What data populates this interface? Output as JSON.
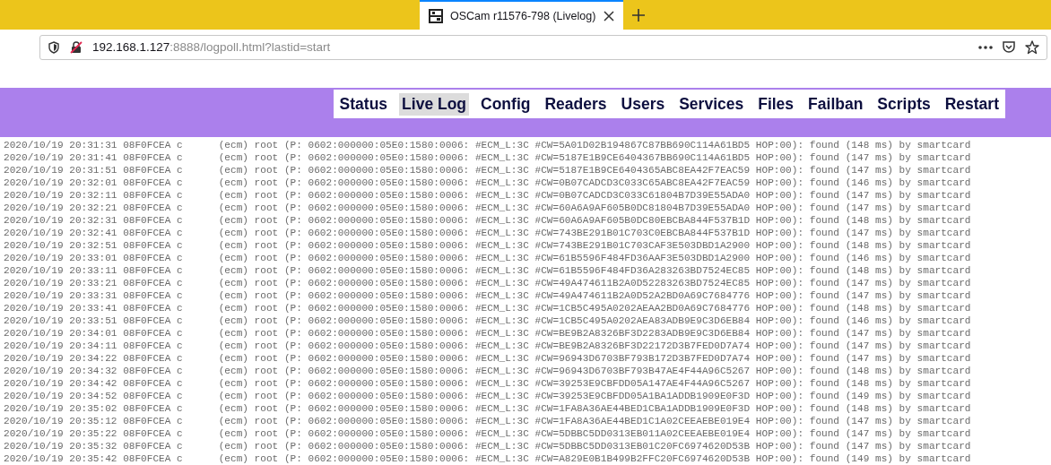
{
  "browser": {
    "tab": {
      "title": "OSCam r11576-798 (Livelog)",
      "selected": true
    },
    "address": {
      "host": "192.168.1.127",
      "rest": ":8888/logpoll.html?lastid=start"
    }
  },
  "menu": [
    {
      "label": "Status",
      "selected": false
    },
    {
      "label": "Live Log",
      "selected": true
    },
    {
      "label": "Config",
      "selected": false
    },
    {
      "label": "Readers",
      "selected": false
    },
    {
      "label": "Users",
      "selected": false
    },
    {
      "label": "Services",
      "selected": false
    },
    {
      "label": "Files",
      "selected": false
    },
    {
      "label": "Failban",
      "selected": false
    },
    {
      "label": "Scripts",
      "selected": false
    },
    {
      "label": "Restart",
      "selected": false
    }
  ],
  "log_lines": [
    "2020/10/19 20:31:31 08F0FCEA c      (ecm) root (P: 0602:000000:05E0:1580:0006: #ECM_L:3C #CW=5A01D02B194867C87BB690C114A61BD5 HOP:00): found (148 ms) by smartcard",
    "2020/10/19 20:31:41 08F0FCEA c      (ecm) root (P: 0602:000000:05E0:1580:0006: #ECM_L:3C #CW=5187E1B9CE6404367BB690C114A61BD5 HOP:00): found (147 ms) by smartcard",
    "2020/10/19 20:31:51 08F0FCEA c      (ecm) root (P: 0602:000000:05E0:1580:0006: #ECM_L:3C #CW=5187E1B9CE6404365ABC8EA42F7EAC59 HOP:00): found (147 ms) by smartcard",
    "2020/10/19 20:32:01 08F0FCEA c      (ecm) root (P: 0602:000000:05E0:1580:0006: #ECM_L:3C #CW=0B07CADCD3C033C65ABC8EA42F7EAC59 HOP:00): found (146 ms) by smartcard",
    "2020/10/19 20:32:11 08F0FCEA c      (ecm) root (P: 0602:000000:05E0:1580:0006: #ECM_L:3C #CW=0B07CADCD3C033C61804B7D39E55ADA0 HOP:00): found (147 ms) by smartcard",
    "2020/10/19 20:32:21 08F0FCEA c      (ecm) root (P: 0602:000000:05E0:1580:0006: #ECM_L:3C #CW=60A6A9AF605B0DC81804B7D39E55ADA0 HOP:00): found (147 ms) by smartcard",
    "2020/10/19 20:32:31 08F0FCEA c      (ecm) root (P: 0602:000000:05E0:1580:0006: #ECM_L:3C #CW=60A6A9AF605B0DC80EBCBA844F537B1D HOP:00): found (148 ms) by smartcard",
    "2020/10/19 20:32:41 08F0FCEA c      (ecm) root (P: 0602:000000:05E0:1580:0006: #ECM_L:3C #CW=743BE291B01C703C0EBCBA844F537B1D HOP:00): found (147 ms) by smartcard",
    "2020/10/19 20:32:51 08F0FCEA c      (ecm) root (P: 0602:000000:05E0:1580:0006: #ECM_L:3C #CW=743BE291B01C703CAF3E503DBD1A2900 HOP:00): found (148 ms) by smartcard",
    "2020/10/19 20:33:01 08F0FCEA c      (ecm) root (P: 0602:000000:05E0:1580:0006: #ECM_L:3C #CW=61B5596F484FD36AAF3E503DBD1A2900 HOP:00): found (146 ms) by smartcard",
    "2020/10/19 20:33:11 08F0FCEA c      (ecm) root (P: 0602:000000:05E0:1580:0006: #ECM_L:3C #CW=61B5596F484FD36A283263BD7524EC85 HOP:00): found (148 ms) by smartcard",
    "2020/10/19 20:33:21 08F0FCEA c      (ecm) root (P: 0602:000000:05E0:1580:0006: #ECM_L:3C #CW=49A474611B2A0D52283263BD7524EC85 HOP:00): found (147 ms) by smartcard",
    "2020/10/19 20:33:31 08F0FCEA c      (ecm) root (P: 0602:000000:05E0:1580:0006: #ECM_L:3C #CW=49A474611B2A0D52A2BD0A69C7684776 HOP:00): found (147 ms) by smartcard",
    "2020/10/19 20:33:41 08F0FCEA c      (ecm) root (P: 0602:000000:05E0:1580:0006: #ECM_L:3C #CW=1CB5C495A0202AEAA2BD0A69C7684776 HOP:00): found (148 ms) by smartcard",
    "2020/10/19 20:33:51 08F0FCEA c      (ecm) root (P: 0602:000000:05E0:1580:0006: #ECM_L:3C #CW=1CB5C495A0202AEA83ADB9E9C3D6EB84 HOP:00): found (146 ms) by smartcard",
    "2020/10/19 20:34:01 08F0FCEA c      (ecm) root (P: 0602:000000:05E0:1580:0006: #ECM_L:3C #CW=BE9B2A8326BF3D2283ADB9E9C3D6EB84 HOP:00): found (147 ms) by smartcard",
    "2020/10/19 20:34:11 08F0FCEA c      (ecm) root (P: 0602:000000:05E0:1580:0006: #ECM_L:3C #CW=BE9B2A8326BF3D22172D3B7FED0D7A74 HOP:00): found (147 ms) by smartcard",
    "2020/10/19 20:34:22 08F0FCEA c      (ecm) root (P: 0602:000000:05E0:1580:0006: #ECM_L:3C #CW=96943D6703BF793B172D3B7FED0D7A74 HOP:00): found (147 ms) by smartcard",
    "2020/10/19 20:34:32 08F0FCEA c      (ecm) root (P: 0602:000000:05E0:1580:0006: #ECM_L:3C #CW=96943D6703BF793B47AE4F44A96C5267 HOP:00): found (148 ms) by smartcard",
    "2020/10/19 20:34:42 08F0FCEA c      (ecm) root (P: 0602:000000:05E0:1580:0006: #ECM_L:3C #CW=39253E9CBFDD05A147AE4F44A96C5267 HOP:00): found (148 ms) by smartcard",
    "2020/10/19 20:34:52 08F0FCEA c      (ecm) root (P: 0602:000000:05E0:1580:0006: #ECM_L:3C #CW=39253E9CBFDD05A1BA1ADDB1909E0F3D HOP:00): found (149 ms) by smartcard",
    "2020/10/19 20:35:02 08F0FCEA c      (ecm) root (P: 0602:000000:05E0:1580:0006: #ECM_L:3C #CW=1FA8A36AE44BED1CBA1ADDB1909E0F3D HOP:00): found (148 ms) by smartcard",
    "2020/10/19 20:35:12 08F0FCEA c      (ecm) root (P: 0602:000000:05E0:1580:0006: #ECM_L:3C #CW=1FA8A36AE44BED1C1A02CEEAEBE019E4 HOP:00): found (147 ms) by smartcard",
    "2020/10/19 20:35:22 08F0FCEA c      (ecm) root (P: 0602:000000:05E0:1580:0006: #ECM_L:3C #CW=5DBBC5DD0313EB011A02CEEAEBE019E4 HOP:00): found (147 ms) by smartcard",
    "2020/10/19 20:35:32 08F0FCEA c      (ecm) root (P: 0602:000000:05E0:1580:0006: #ECM_L:3C #CW=5DBBC5DD0313EB01C20FC6974620D53B HOP:00): found (147 ms) by smartcard",
    "2020/10/19 20:35:42 08F0FCEA c      (ecm) root (P: 0602:000000:05E0:1580:0006: #ECM_L:3C #CW=A829E0B1B499B2FFC20FC6974620D53B HOP:00): found (149 ms) by smartcard"
  ]
}
